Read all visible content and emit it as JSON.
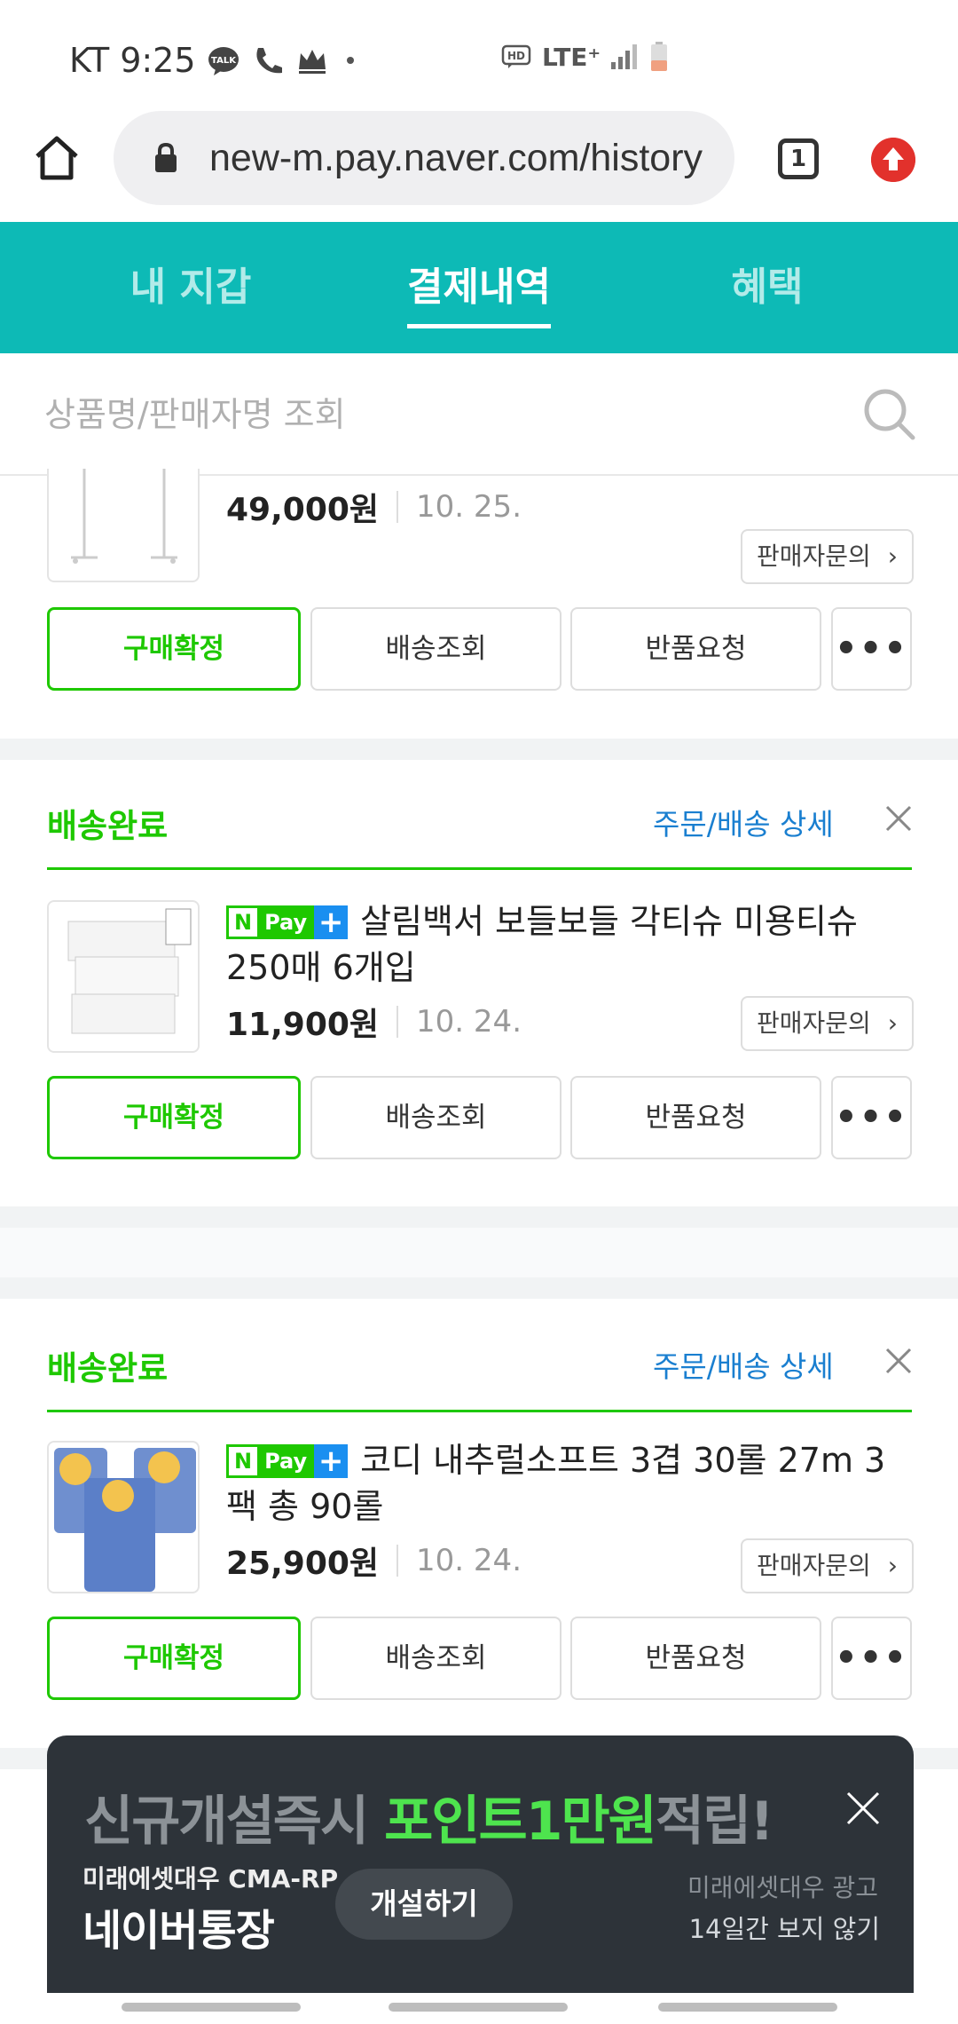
{
  "status_bar": {
    "carrier": "KT",
    "time": "9:25",
    "network": "LTE⁺",
    "hd": "HD"
  },
  "browser": {
    "url": "new-m.pay.naver.com/history",
    "tab_count": "1"
  },
  "nav_tabs": [
    {
      "label": "내 지갑",
      "active": false
    },
    {
      "label": "결제내역",
      "active": true
    },
    {
      "label": "혜택",
      "active": false
    }
  ],
  "search": {
    "placeholder": "상품명/판매자명 조회"
  },
  "orders": [
    {
      "status": "",
      "detail_label": "",
      "title": "",
      "price": "49,000원",
      "date": "10. 25.",
      "seller_label": "판매자문의",
      "buttons": {
        "confirm": "구매확정",
        "track": "배송조회",
        "return": "반품요청",
        "more": "•••"
      }
    },
    {
      "status": "배송완료",
      "detail_label": "주문/배송 상세",
      "npay_badge": {
        "n": "N",
        "pay": "Pay",
        "plus": "+"
      },
      "title": "살림백서 보들보들 각티슈 미용티슈 250매 6개입",
      "price": "11,900원",
      "date": "10. 24.",
      "seller_label": "판매자문의",
      "buttons": {
        "confirm": "구매확정",
        "track": "배송조회",
        "return": "반품요청",
        "more": "•••"
      }
    },
    {
      "status": "배송완료",
      "detail_label": "주문/배송 상세",
      "npay_badge": {
        "n": "N",
        "pay": "Pay",
        "plus": "+"
      },
      "title": "코디 내추럴소프트 3겹 30롤 27m 3팩 총 90롤",
      "price": "25,900원",
      "date": "10. 24.",
      "seller_label": "판매자문의",
      "buttons": {
        "confirm": "구매확정",
        "track": "배송조회",
        "return": "반품요청",
        "more": "•••"
      }
    }
  ],
  "ad": {
    "title_pre": "신규개설즉시 ",
    "title_highlight": "포인트1만원",
    "title_post": "적립!",
    "brand_small": "미래에셋대우 CMA-RP",
    "brand_big": "네이버통장",
    "cta": "개설하기",
    "label": "미래에셋대우 광고",
    "hide": "14일간 보지 않기"
  },
  "colors": {
    "teal": "#0dbab6",
    "naver_green": "#1ec800",
    "link_blue": "#1a7fd0",
    "ad_bg": "#2d3339"
  }
}
